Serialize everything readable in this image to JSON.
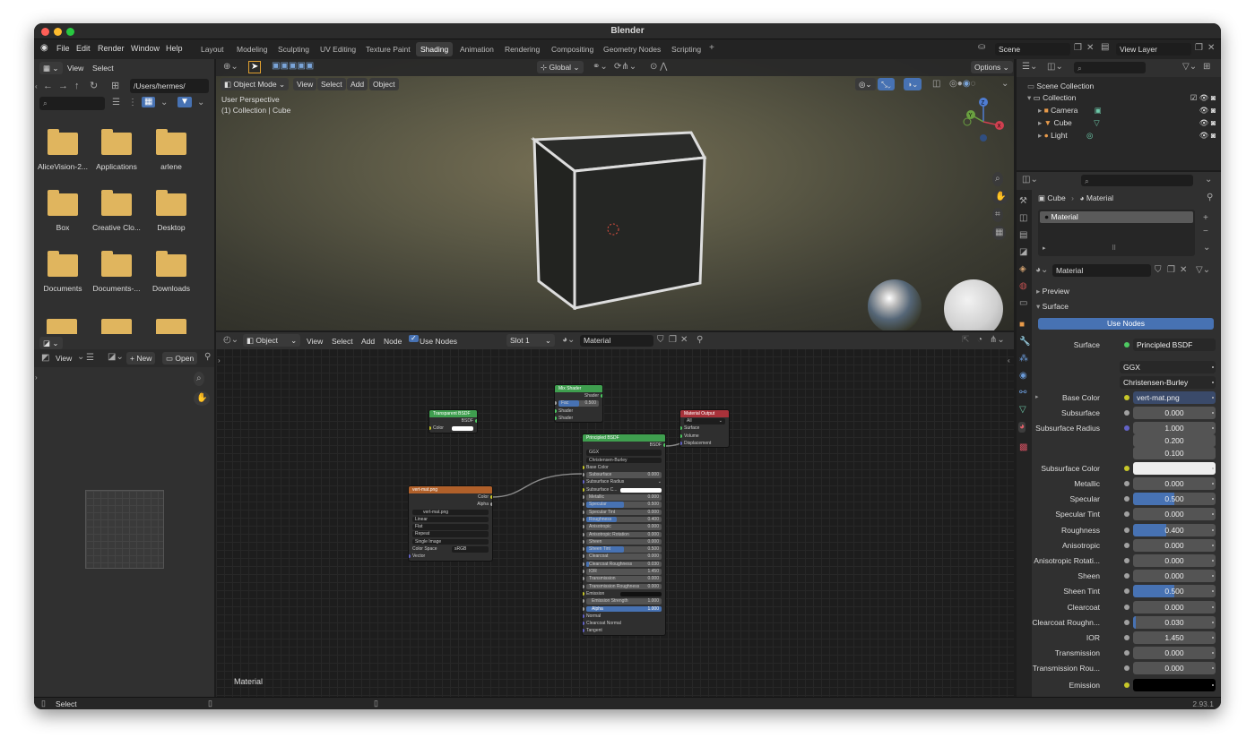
{
  "app": {
    "title": "Blender",
    "version": "2.93.1"
  },
  "menu": [
    "File",
    "Edit",
    "Render",
    "Window",
    "Help"
  ],
  "workspaces": [
    "Layout",
    "Modeling",
    "Sculpting",
    "UV Editing",
    "Texture Paint",
    "Shading",
    "Animation",
    "Rendering",
    "Compositing",
    "Geometry Nodes",
    "Scripting"
  ],
  "active_workspace": "Shading",
  "scene": "Scene",
  "view_layer": "View Layer",
  "file_browser": {
    "menu": [
      "View",
      "Select"
    ],
    "path": "/Users/hermes/",
    "folders": [
      "AliceVision-2...",
      "Applications",
      "arlene",
      "Box",
      "Creative Clo...",
      "Desktop",
      "Documents",
      "Documents-...",
      "Downloads"
    ]
  },
  "image_editor": {
    "view_menu": "View",
    "new_btn": "New",
    "open_btn": "Open"
  },
  "viewport": {
    "mode": "Object Mode",
    "menus": [
      "View",
      "Select",
      "Add",
      "Object"
    ],
    "orientation": "Global",
    "options": "Options",
    "perspective": "User Perspective",
    "collection": "(1) Collection | Cube"
  },
  "node_editor": {
    "type": "Object",
    "menus": [
      "View",
      "Select",
      "Add",
      "Node"
    ],
    "use_nodes": "Use Nodes",
    "slot": "Slot 1",
    "material": "Material",
    "footer": "Material"
  },
  "nodes": {
    "mix": {
      "title": "Mix Shader",
      "out": "Shader",
      "fac_label": "Fac",
      "fac_value": "0.500",
      "in1": "Shader",
      "in2": "Shader"
    },
    "transparent": {
      "title": "Transparent BSDF",
      "out": "BSDF",
      "in": "Color"
    },
    "output": {
      "title": "Material Output",
      "target": "All",
      "surface": "Surface",
      "volume": "Volume",
      "displacement": "Displacement"
    },
    "image": {
      "title": "vert-mat.png",
      "out_color": "Color",
      "out_alpha": "Alpha",
      "file": "vert-mat.png",
      "interp": "Linear",
      "proj": "Flat",
      "ext": "Repeat",
      "source": "Single Image",
      "cs_label": "Color Space",
      "cs_value": "sRGB",
      "vector": "Vector"
    },
    "principled": {
      "title": "Principled BSDF",
      "out": "BSDF",
      "dist": "GGX",
      "sss": "Christensen-Burley",
      "base_color": "Base Color",
      "subsurface": "Subsurface",
      "subsurface_radius": "Subsurface Radius",
      "subsurface_color": "Subsurface C...",
      "emission": "Emission",
      "normal": "Normal",
      "clearcoat_normal": "Clearcoat Normal",
      "tangent": "Tangent",
      "sliders": [
        {
          "label": "Metallic",
          "value": "0.000",
          "fill": 0
        },
        {
          "label": "Specular",
          "value": "0.500",
          "fill": 0.5
        },
        {
          "label": "Specular Tint",
          "value": "0.000",
          "fill": 0
        },
        {
          "label": "Roughness",
          "value": "0.400",
          "fill": 0.4
        },
        {
          "label": "Anisotropic",
          "value": "0.000",
          "fill": 0
        },
        {
          "label": "Anisotropic Rotation",
          "value": "0.000",
          "fill": 0
        },
        {
          "label": "Sheen",
          "value": "0.000",
          "fill": 0
        },
        {
          "label": "Sheen Tint",
          "value": "0.500",
          "fill": 0.5
        },
        {
          "label": "Clearcoat",
          "value": "0.000",
          "fill": 0
        },
        {
          "label": "Clearcoat Roughness",
          "value": "0.030",
          "fill": 0.03
        },
        {
          "label": "IOR",
          "value": "1.450",
          "fill": 0
        },
        {
          "label": "Transmission",
          "value": "0.000",
          "fill": 0
        },
        {
          "label": "Transmission Roughness",
          "value": "0.000",
          "fill": 0
        }
      ],
      "emission_strength": {
        "label": "Emission Strength",
        "value": "1.000"
      },
      "alpha": {
        "label": "Alpha",
        "value": "1.000",
        "fill": 1
      }
    }
  },
  "outliner": {
    "root": "Scene Collection",
    "collection": "Collection",
    "items": [
      "Camera",
      "Cube",
      "Light"
    ]
  },
  "properties": {
    "object": "Cube",
    "material_label": "Material",
    "slot": "Material",
    "material_name": "Material",
    "preview": "Preview",
    "surface": "Surface",
    "use_nodes": "Use Nodes",
    "surface_label": "Surface",
    "surface_value": "Principled BSDF",
    "dist": "GGX",
    "sss": "Christensen-Burley",
    "base_color_label": "Base Color",
    "base_color_value": "vert-mat.png",
    "subsurface_label": "Subsurface",
    "subsurface_value": "0.000",
    "radius_label": "Subsurface Radius",
    "radius": [
      "1.000",
      "0.200",
      "0.100"
    ],
    "sub_color_label": "Subsurface Color",
    "rows": [
      {
        "label": "Metallic",
        "value": "0.000",
        "fill": 0
      },
      {
        "label": "Specular",
        "value": "0.500",
        "fill": 0.5
      },
      {
        "label": "Specular Tint",
        "value": "0.000",
        "fill": 0
      },
      {
        "label": "Roughness",
        "value": "0.400",
        "fill": 0.4
      },
      {
        "label": "Anisotropic",
        "value": "0.000",
        "fill": 0
      },
      {
        "label": "Anisotropic Rotati...",
        "value": "0.000",
        "fill": 0
      },
      {
        "label": "Sheen",
        "value": "0.000",
        "fill": 0
      },
      {
        "label": "Sheen Tint",
        "value": "0.500",
        "fill": 0.5
      },
      {
        "label": "Clearcoat",
        "value": "0.000",
        "fill": 0
      },
      {
        "label": "Clearcoat Roughn...",
        "value": "0.030",
        "fill": 0.03
      },
      {
        "label": "IOR",
        "value": "1.450",
        "fill": 0
      },
      {
        "label": "Transmission",
        "value": "0.000",
        "fill": 0
      },
      {
        "label": "Transmission Rou...",
        "value": "0.000",
        "fill": 0
      }
    ],
    "emission_label": "Emission"
  },
  "status": {
    "select": "Select"
  },
  "colors": {
    "accent": "#4772b3",
    "folder": "#e0b55e",
    "shader_header": "#3f9f4f",
    "output_header": "#a8323a",
    "texture_header": "#b0602a",
    "socket_shader": "#4ec962",
    "socket_color": "#c7c729",
    "socket_float": "#a1a1a1",
    "socket_vector": "#6363c7"
  }
}
